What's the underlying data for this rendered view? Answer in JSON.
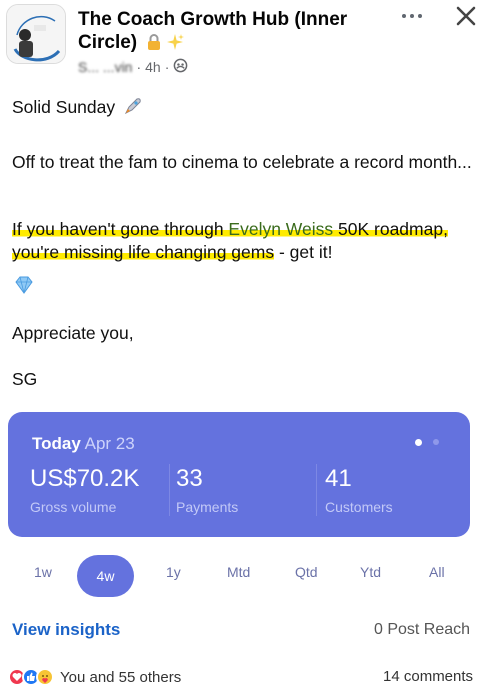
{
  "header": {
    "group_title": "The Coach Growth Hub (Inner Circle)",
    "author_name": "S... ...vin",
    "timestamp": "4h",
    "separator": "·",
    "privacy_icon": "group-audience-icon",
    "more_icon": "more-options-icon",
    "close_icon": "close-icon"
  },
  "post": {
    "line1": "Solid Sunday",
    "line2": "Off to treat the fam to cinema to celebrate a record month...",
    "line3_prefix": "If you haven't gone through ",
    "line3_mention": "Evelyn Weiss",
    "line3_suffix": " 50K roadmap, you're missing life changing gems",
    "line3_tail": " - get it!",
    "line4": "Appreciate you,",
    "line5": "SG"
  },
  "stats_card": {
    "today_label": "Today",
    "date": "Apr 23",
    "gross_volume": "US$70.2K",
    "gross_volume_label": "Gross volume",
    "payments": "33",
    "payments_label": "Payments",
    "customers": "41",
    "customers_label": "Customers",
    "accent_color": "#6472de"
  },
  "ranges": {
    "r1w": "1w",
    "r4w": "4w",
    "r1y": "1y",
    "rmtd": "Mtd",
    "rqtd": "Qtd",
    "rytd": "Ytd",
    "rall": "All",
    "selected": "4w"
  },
  "footer": {
    "view_insights": "View insights",
    "post_reach": "0 Post Reach",
    "reactions_text": "You and 55 others",
    "comments": "14 comments",
    "link_color": "#1b63c8"
  }
}
